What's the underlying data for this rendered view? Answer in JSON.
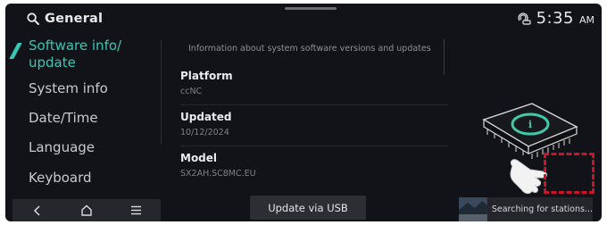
{
  "header": {
    "title": "General",
    "time": "5:35",
    "ampm": "AM"
  },
  "sidebar": {
    "items": [
      {
        "label": "Software info/\nupdate",
        "line1": "Software info/",
        "line2": "update",
        "active": true
      },
      {
        "label": "System info"
      },
      {
        "label": "Date/Time"
      },
      {
        "label": "Language"
      },
      {
        "label": "Keyboard"
      }
    ]
  },
  "content": {
    "description": "Information about system software versions and updates",
    "rows": [
      {
        "label": "Platform",
        "value": "ccNC"
      },
      {
        "label": "Updated",
        "value": "10/12/2024"
      },
      {
        "label": "Model",
        "value": "SX2AH.SC8MC.EU"
      }
    ],
    "update_button": "Update via USB"
  },
  "radio": {
    "status": "Searching for stations..."
  },
  "colors": {
    "accent": "#36c7b3",
    "background": "#111318",
    "highlight_box": "#c8152b"
  },
  "icons": [
    "search-icon",
    "connected-car-icon",
    "back-icon",
    "home-icon",
    "menu-icon",
    "chip-info-icon",
    "touch-hand-icon"
  ]
}
